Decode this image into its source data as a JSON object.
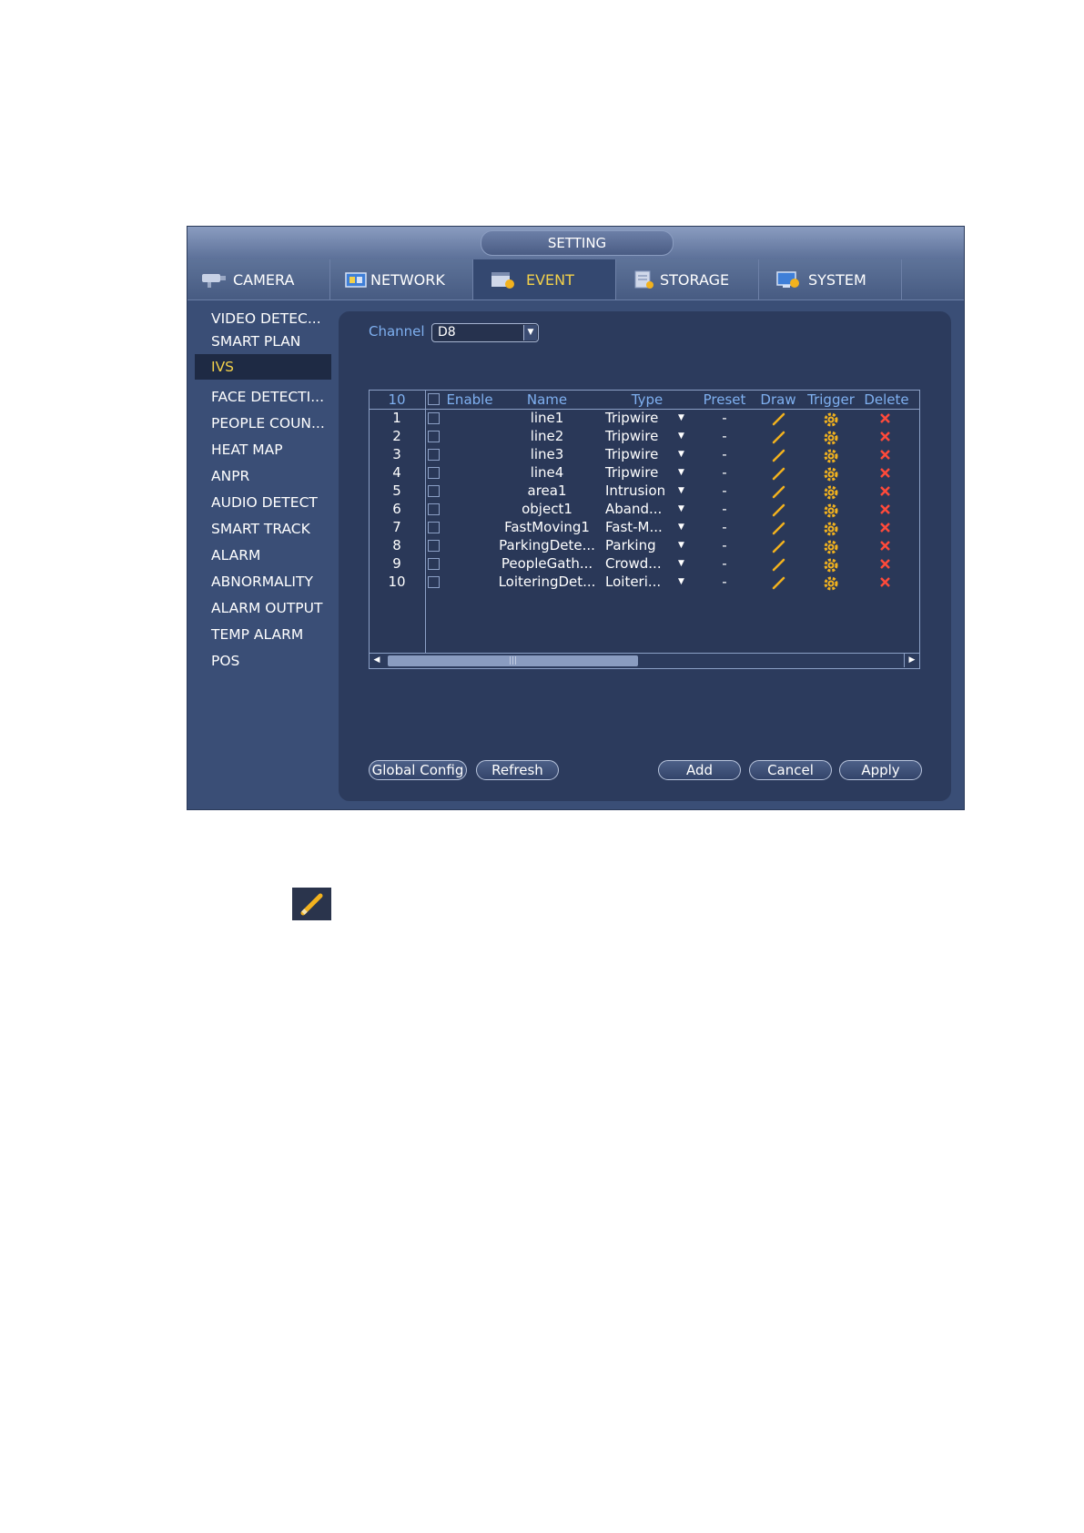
{
  "window": {
    "title": "SETTING"
  },
  "tabs": [
    {
      "label": "CAMERA",
      "icon": "camera-icon"
    },
    {
      "label": "NETWORK",
      "icon": "network-icon"
    },
    {
      "label": "EVENT",
      "icon": "event-icon",
      "active": true
    },
    {
      "label": "STORAGE",
      "icon": "storage-icon"
    },
    {
      "label": "SYSTEM",
      "icon": "system-icon"
    }
  ],
  "sidebar": {
    "items": [
      {
        "label": "VIDEO DETEC..."
      },
      {
        "label": "SMART PLAN"
      },
      {
        "label": "IVS",
        "active": true
      },
      {
        "label": "FACE DETECTI..."
      },
      {
        "label": "PEOPLE COUN..."
      },
      {
        "label": "HEAT MAP"
      },
      {
        "label": "ANPR"
      },
      {
        "label": "AUDIO DETECT"
      },
      {
        "label": "SMART TRACK"
      },
      {
        "label": "ALARM"
      },
      {
        "label": "ABNORMALITY"
      },
      {
        "label": "ALARM OUTPUT"
      },
      {
        "label": "TEMP ALARM"
      },
      {
        "label": "POS"
      }
    ]
  },
  "channel": {
    "label": "Channel",
    "value": "D8"
  },
  "table": {
    "count": "10",
    "headers": {
      "enable": "Enable",
      "name": "Name",
      "type": "Type",
      "preset": "Preset",
      "draw": "Draw",
      "trigger": "Trigger",
      "delete": "Delete"
    },
    "rows": [
      {
        "no": "1",
        "name": "line1",
        "type": "Tripwire",
        "preset": "-"
      },
      {
        "no": "2",
        "name": "line2",
        "type": "Tripwire",
        "preset": "-"
      },
      {
        "no": "3",
        "name": "line3",
        "type": "Tripwire",
        "preset": "-"
      },
      {
        "no": "4",
        "name": "line4",
        "type": "Tripwire",
        "preset": "-"
      },
      {
        "no": "5",
        "name": "area1",
        "type": "Intrusion",
        "preset": "-"
      },
      {
        "no": "6",
        "name": "object1",
        "type": "Aband...",
        "preset": "-"
      },
      {
        "no": "7",
        "name": "FastMoving1",
        "type": "Fast-M...",
        "preset": "-"
      },
      {
        "no": "8",
        "name": "ParkingDete...",
        "type": "Parking",
        "preset": "-"
      },
      {
        "no": "9",
        "name": "PeopleGath...",
        "type": "Crowd...",
        "preset": "-"
      },
      {
        "no": "10",
        "name": "LoiteringDet...",
        "type": "Loiteri...",
        "preset": "-"
      }
    ]
  },
  "buttons": {
    "global_config": "Global Config",
    "refresh": "Refresh",
    "add": "Add",
    "cancel": "Cancel",
    "apply": "Apply"
  },
  "colors": {
    "accent_yellow": "#f3d14a",
    "header_blue": "#7fb0f0",
    "panel_bg": "#2c3b5d",
    "window_bg": "#3a4e76",
    "delete_red": "#ff4a3a",
    "gear_orange": "#f2b21e"
  }
}
